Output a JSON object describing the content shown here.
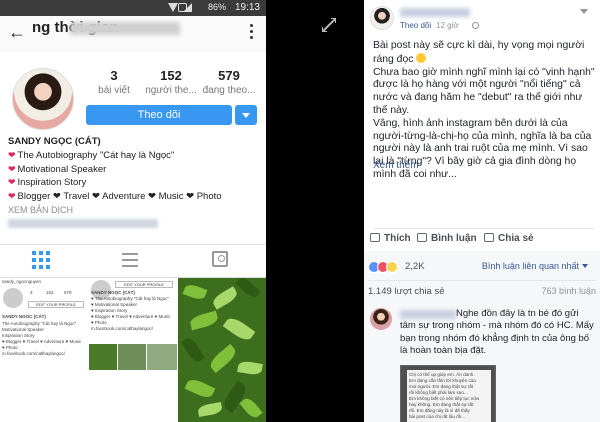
{
  "phone": {
    "status": {
      "battery": "86%",
      "time": "19:13"
    },
    "header": {
      "title": "ng thời gian"
    },
    "profile": {
      "stats": [
        {
          "value": "3",
          "label": "bài viết"
        },
        {
          "value": "152",
          "label": "người the..."
        },
        {
          "value": "579",
          "label": "đang theo..."
        }
      ],
      "follow_label": "Theo dõi",
      "name": "SANDY NGỌC (CÁT)",
      "bio_lines": [
        "The Autobiography \"Cát hay là Ngọc\"",
        "Motivational Speaker",
        "Inspiration Story"
      ],
      "bio_tags": "Blogger ❤ Travel ❤ Adventure ❤ Music ❤ Photo",
      "translate_label": "XEM BẢN DỊCH"
    },
    "thumb1": {
      "username": "sandy_ngocnguyen",
      "stats": [
        "3",
        "152",
        "579"
      ],
      "edit_label": "EDIT YOUR PROFILE",
      "name": "SANDY NGOC (CÁT)",
      "lines": [
        "The Autobiography \"Cát hay là Ngọc\"",
        "Motivational Speaker",
        "Inspiration Story",
        "♥ Blogger ♥ Travel ♥ Adventure ♥ Music",
        "♥ Photo",
        "m.facebook.com/catlhaylangoc/"
      ]
    },
    "thumb2": {
      "edit_label": "EDIT YOUR PROFILE",
      "name": "SANDY NGỌC (CÁT)",
      "lines": [
        "♥ The Autobiography \"Cát hay là Ngọc\"",
        "♥ Motivational Speaker",
        "♥ Inspiration Story",
        "♥ Blogger ♥ Travel ♥ Adventure ♥ Music",
        "♥ Photo",
        "m.facebook.com/cathaylangoc/"
      ]
    }
  },
  "post": {
    "follow_label": "Theo dõi",
    "time": "12 giờ",
    "paragraphs": [
      "Bài post này sẽ cực kì dài, hy vọng mọi người ráng đọc",
      "Chưa bao giờ mình nghĩ mình lại có \"vinh hạnh\" được là họ hàng với một người \"nổi tiếng\" cả nước và đang hăm he \"debut\" ra thế giới như thế này.",
      "Vâng, hình ảnh instagram bên dưới là của người-từng-là-chị-họ của mình, nghĩa là ba của người này là anh trai ruột của mẹ mình. Vì sao lại là \"từng\"? Vì bây giờ cả gia đình dòng họ mình đã coi như..."
    ],
    "see_more": "Xem thêm",
    "actions": {
      "like": "Thích",
      "comment": "Bình luận",
      "share": "Chia sẻ"
    },
    "reaction_count": "2,2K",
    "sort_label": "Bình luận liên quan nhất",
    "shares": "1.149 lượt chia sẻ",
    "comments_count": "763 bình luận"
  },
  "comment": {
    "text": "Nghe đồn đây là tn bé đó gửi tâm sự trong nhóm - mà nhóm đó có HC. Mấy bạn trong nhóm đó khẳng định tn của ông bố là hoàn toàn bịa đặt.",
    "image_lines": [
      "Chị có thể up giúp em. Ăn danh.",
      "Em đang cần lắm lời khuyên của",
      "mọi người. Em đang thật sự rất",
      "rối không biết phải làm sao...",
      "Em không biết có nên tiếp tục nữa",
      "hay không. Em đang thật sự rất",
      "rối. Em đăng này là vì đã thấy",
      "bài post của chị rất lâu rồi..."
    ]
  },
  "colors": {
    "instagram_blue": "#3897f0",
    "facebook_link": "#365899",
    "heart_red": "#e0245e"
  }
}
